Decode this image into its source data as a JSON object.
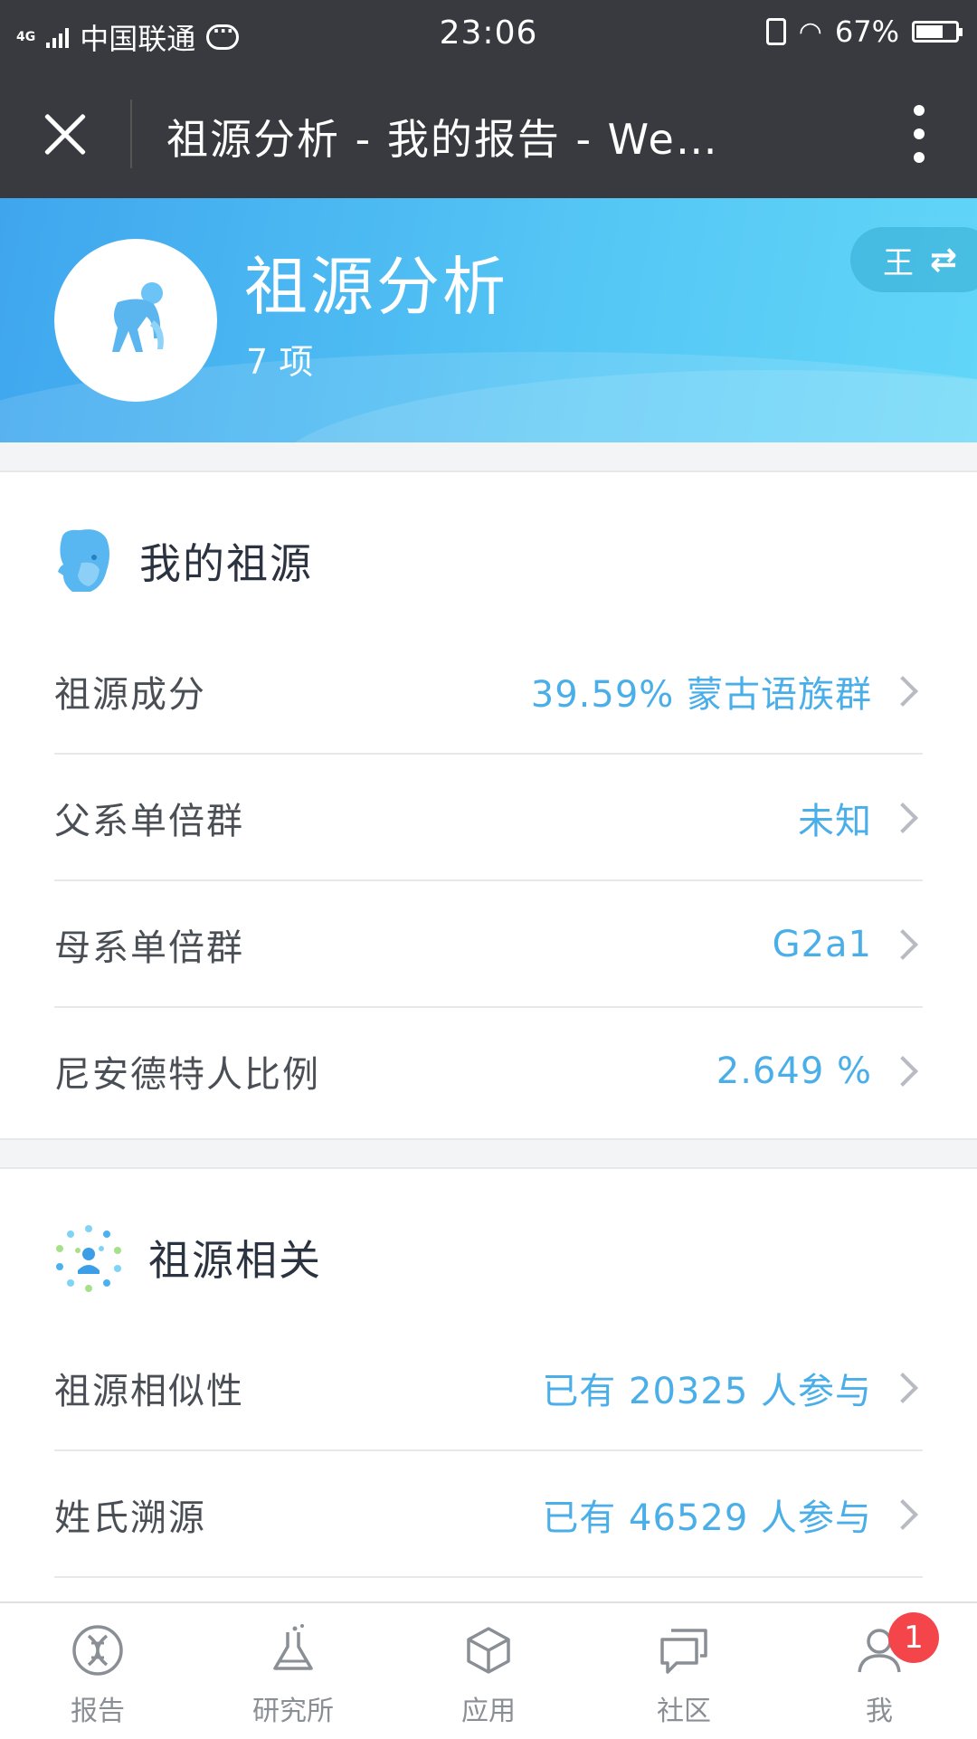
{
  "status_bar": {
    "network": "4G",
    "carrier": "中国联通",
    "time": "23:06",
    "battery": "67%"
  },
  "title_bar": {
    "title": "祖源分析 - 我的报告 - We…"
  },
  "hero": {
    "title": "祖源分析",
    "count": "7 项",
    "switch_label": "王"
  },
  "section_ancestry": {
    "title": "我的祖源",
    "rows": [
      {
        "label": "祖源成分",
        "value": "39.59% 蒙古语族群"
      },
      {
        "label": "父系单倍群",
        "value": "未知"
      },
      {
        "label": "母系单倍群",
        "value": "G2a1"
      },
      {
        "label": "尼安德特人比例",
        "value": "2.649 %"
      }
    ]
  },
  "section_related": {
    "title": "祖源相关",
    "rows": [
      {
        "label": "祖源相似性",
        "value": "已有 20325 人参与"
      },
      {
        "label": "姓氏溯源",
        "value": "已有 46529 人参与"
      }
    ]
  },
  "tabs": [
    {
      "label": "报告",
      "icon": "dna-icon"
    },
    {
      "label": "研究所",
      "icon": "flask-icon"
    },
    {
      "label": "应用",
      "icon": "cube-icon"
    },
    {
      "label": "社区",
      "icon": "chat-icon"
    },
    {
      "label": "我",
      "icon": "person-icon",
      "badge": "1"
    }
  ],
  "colors": {
    "accent": "#4aaee8",
    "header_bg": "#393a3f",
    "badge": "#f4464a"
  }
}
